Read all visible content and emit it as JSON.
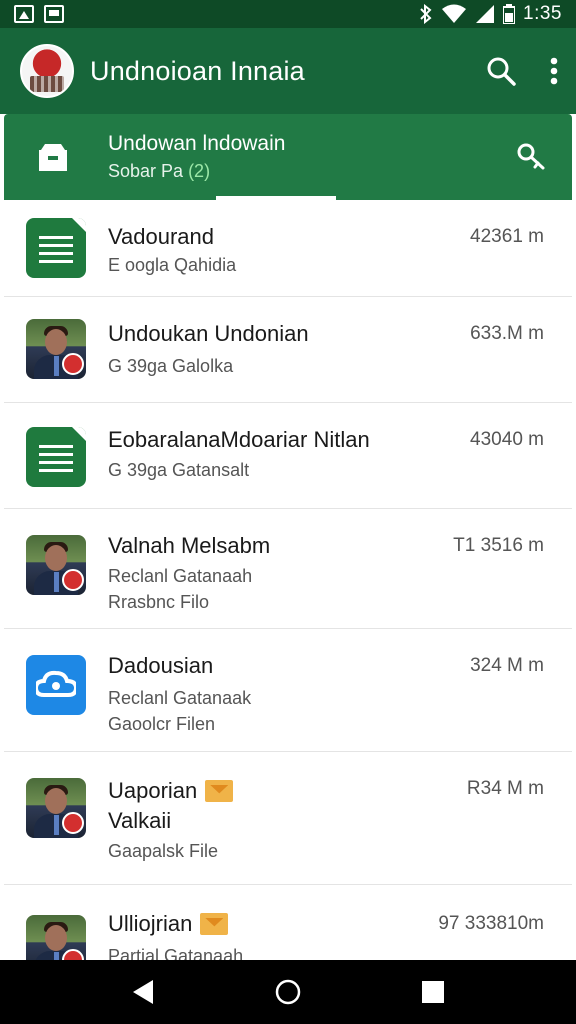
{
  "status_bar": {
    "time": "1:35",
    "icons": [
      "gallery-icon",
      "message-icon",
      "bluetooth-icon",
      "wifi-icon",
      "signal-icon",
      "battery-icon"
    ]
  },
  "app_bar": {
    "title": "Undnoioan Innaia",
    "logo_icon": "app-logo-icon",
    "actions": [
      "search-icon",
      "more-vert-icon"
    ]
  },
  "sub_header": {
    "title": "Undowan lndowain",
    "subtitle_prefix": "Sobar Pa ",
    "subtitle_count": "(2)",
    "left_icon": "inbox-icon",
    "right_icon": "key-icon"
  },
  "files": [
    {
      "thumb": "doc",
      "title": "Vadourand",
      "lines": [
        "E oogla Qahidia"
      ],
      "size": "42361 m",
      "badge": false
    },
    {
      "thumb": "photo",
      "title": "Undoukan Undonian",
      "lines": [
        "G 39ga Galolka"
      ],
      "size": "633.M m",
      "badge": false
    },
    {
      "thumb": "doc",
      "title": "EobaralanaMdoariar Nitlan",
      "lines": [
        "G 39ga Gatansalt"
      ],
      "size": "43040 m",
      "badge": false
    },
    {
      "thumb": "photo",
      "title": "Valnah Melsabm",
      "lines": [
        "Reclanl Gatanaah",
        "Rrasbnc Filo"
      ],
      "size": "T1 3516 m",
      "badge": false
    },
    {
      "thumb": "cloud",
      "title": "Dadousian",
      "lines": [
        "Reclanl Gatanaak",
        "Gaoolcr Filen"
      ],
      "size": "324 M m",
      "badge": false
    },
    {
      "thumb": "photo",
      "title": "Uaporian",
      "lines": [
        "Valkaii",
        "Gaapalsk File"
      ],
      "size": "R34 M m",
      "badge": true
    },
    {
      "thumb": "photo",
      "title": "Ulliojrian",
      "lines": [
        "Partial Gatanaah"
      ],
      "size": "97 333810m",
      "badge": true
    }
  ],
  "nav_bar": {
    "buttons": [
      "back-icon",
      "home-icon",
      "recents-icon"
    ]
  },
  "colors": {
    "status_bar": "#0e4a26",
    "app_bar": "#17663a",
    "sub_header": "#217a45",
    "accent_count": "#9be7a7"
  }
}
